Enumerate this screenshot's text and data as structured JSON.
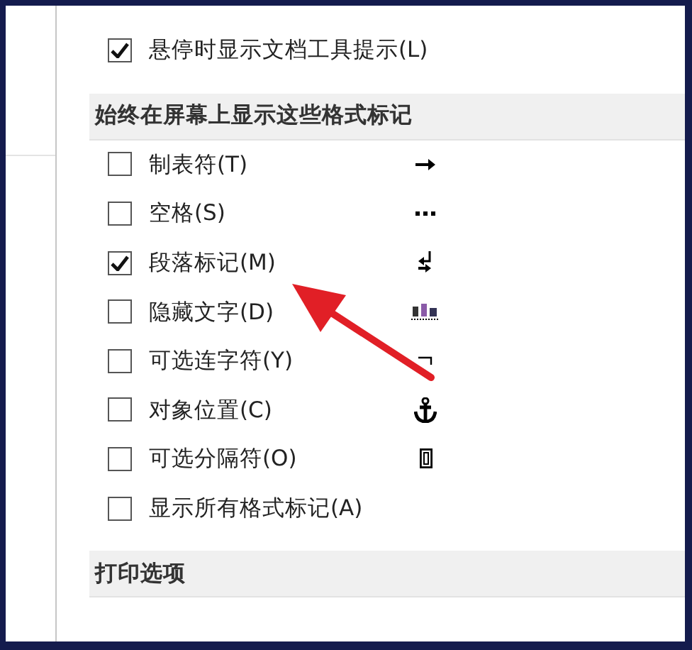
{
  "options_top": [
    {
      "label": "悬停时显示文档工具提示(L)",
      "checked": true
    }
  ],
  "sections": [
    {
      "title": "始终在屏幕上显示这些格式标记",
      "options": [
        {
          "label": "制表符(T)",
          "checked": false,
          "kind": "tab"
        },
        {
          "label": "空格(S)",
          "checked": false,
          "kind": "space"
        },
        {
          "label": "段落标记(M)",
          "checked": true,
          "kind": "paragraph"
        },
        {
          "label": "隐藏文字(D)",
          "checked": false,
          "kind": "hidden"
        },
        {
          "label": "可选连字符(Y)",
          "checked": false,
          "kind": "hyphen"
        },
        {
          "label": "对象位置(C)",
          "checked": false,
          "kind": "anchor"
        },
        {
          "label": "可选分隔符(O)",
          "checked": false,
          "kind": "separator"
        },
        {
          "label": "显示所有格式标记(A)",
          "checked": false,
          "kind": "none"
        }
      ]
    },
    {
      "title": "打印选项"
    }
  ]
}
